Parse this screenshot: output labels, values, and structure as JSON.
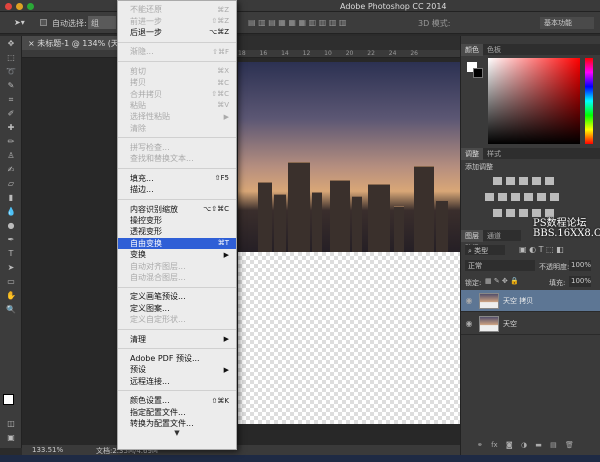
{
  "window": {
    "title": "Adobe Photoshop CC 2014"
  },
  "options_bar": {
    "auto_select_label": "自动选择:",
    "auto_select_value": "组",
    "mode_3d": "3D 模式:",
    "workspace": "基本功能"
  },
  "document": {
    "tab": "未标题-1 @ 134% (天空 拷贝, RGB/8)",
    "zoom": "133.51%",
    "doc_info": "文档:2.35M/4.69M"
  },
  "ruler_ticks": [
    "18",
    "16",
    "14",
    "12",
    "10",
    "20",
    "22",
    "24",
    "26"
  ],
  "edit_menu": {
    "items": [
      {
        "label": "不能还原",
        "shortcut": "⌘Z",
        "disabled": true
      },
      {
        "label": "前进一步",
        "shortcut": "⇧⌘Z",
        "disabled": true
      },
      {
        "label": "后退一步",
        "shortcut": "⌥⌘Z"
      },
      {
        "sep": true
      },
      {
        "label": "渐隐...",
        "shortcut": "⇧⌘F",
        "disabled": true
      },
      {
        "sep": true
      },
      {
        "label": "剪切",
        "shortcut": "⌘X",
        "disabled": true
      },
      {
        "label": "拷贝",
        "shortcut": "⌘C",
        "disabled": true
      },
      {
        "label": "合并拷贝",
        "shortcut": "⇧⌘C",
        "disabled": true
      },
      {
        "label": "粘贴",
        "shortcut": "⌘V",
        "disabled": true
      },
      {
        "label": "选择性粘贴",
        "shortcut": "▶",
        "disabled": true
      },
      {
        "label": "清除",
        "shortcut": "",
        "disabled": true
      },
      {
        "sep": true
      },
      {
        "label": "拼写检查...",
        "shortcut": "",
        "disabled": true
      },
      {
        "label": "查找和替换文本...",
        "shortcut": "",
        "disabled": true
      },
      {
        "sep": true
      },
      {
        "label": "填充...",
        "shortcut": "⇧F5"
      },
      {
        "label": "描边...",
        "shortcut": ""
      },
      {
        "sep": true
      },
      {
        "label": "内容识别缩放",
        "shortcut": "⌥⇧⌘C"
      },
      {
        "label": "操控变形",
        "shortcut": ""
      },
      {
        "label": "透视变形",
        "shortcut": ""
      },
      {
        "label": "自由变换",
        "shortcut": "⌘T",
        "highlighted": true
      },
      {
        "label": "变换",
        "shortcut": "▶"
      },
      {
        "label": "自动对齐图层...",
        "shortcut": "",
        "disabled": true
      },
      {
        "label": "自动混合图层...",
        "shortcut": "",
        "disabled": true
      },
      {
        "sep": true
      },
      {
        "label": "定义画笔预设...",
        "shortcut": ""
      },
      {
        "label": "定义图案...",
        "shortcut": ""
      },
      {
        "label": "定义自定形状...",
        "shortcut": "",
        "disabled": true
      },
      {
        "sep": true
      },
      {
        "label": "清理",
        "shortcut": "▶"
      },
      {
        "sep": true
      },
      {
        "label": "Adobe PDF 预设...",
        "shortcut": ""
      },
      {
        "label": "预设",
        "shortcut": "▶"
      },
      {
        "label": "远程连接...",
        "shortcut": ""
      },
      {
        "sep": true
      },
      {
        "label": "颜色设置...",
        "shortcut": "⇧⌘K"
      },
      {
        "label": "指定配置文件...",
        "shortcut": ""
      },
      {
        "label": "转换为配置文件...",
        "shortcut": ""
      }
    ],
    "more_arrow": "▼"
  },
  "panels": {
    "color_tabs": [
      "颜色",
      "色板"
    ],
    "adjust_tabs": [
      "调整",
      "样式"
    ],
    "adjust_title": "添加调整",
    "layers_tabs": [
      "图层",
      "通道",
      "路径"
    ],
    "filter_kind": "类型",
    "blend_mode": "正常",
    "opacity_label": "不透明度:",
    "opacity": "100%",
    "lock_label": "锁定:",
    "fill_label": "填充:",
    "fill": "100%",
    "layers": [
      {
        "name": "天空 拷贝",
        "selected": true
      },
      {
        "name": "天空",
        "selected": false
      }
    ]
  },
  "watermark": {
    "line1": "PS数程论坛",
    "line2": "BBS.16XX8.COM"
  },
  "colors": {
    "highlight": "#2f5fd6",
    "layer_selected": "#5d7694"
  }
}
